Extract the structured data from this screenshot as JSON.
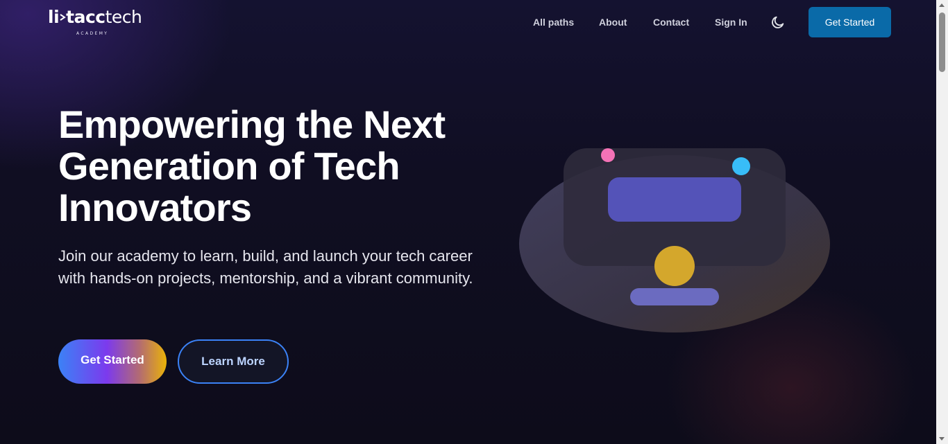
{
  "brand": {
    "logo_text_1": "li",
    "logo_text_2": "tacc",
    "logo_text_3": "tech",
    "logo_sub": "ACADEMY"
  },
  "nav": {
    "links": [
      {
        "label": "All paths"
      },
      {
        "label": "About"
      },
      {
        "label": "Contact"
      },
      {
        "label": "Sign In"
      }
    ],
    "theme_icon": "moon-icon",
    "cta_label": "Get Started",
    "cta_color": "#0a6aa8"
  },
  "hero": {
    "title": "Empowering the Next Generation of Tech Innovators",
    "subtitle": "Join our academy to learn, build, and launch your tech career with hands-on projects, mentorship, and a vibrant community.",
    "primary_label": "Get Started",
    "secondary_label": "Learn More"
  },
  "colors": {
    "background": "#0f0d1e",
    "accent_blue": "#3b82f6",
    "accent_purple": "#7c3aed",
    "accent_gold": "#eab308",
    "dot_pink": "#f472b6",
    "dot_cyan": "#38bdf8"
  }
}
